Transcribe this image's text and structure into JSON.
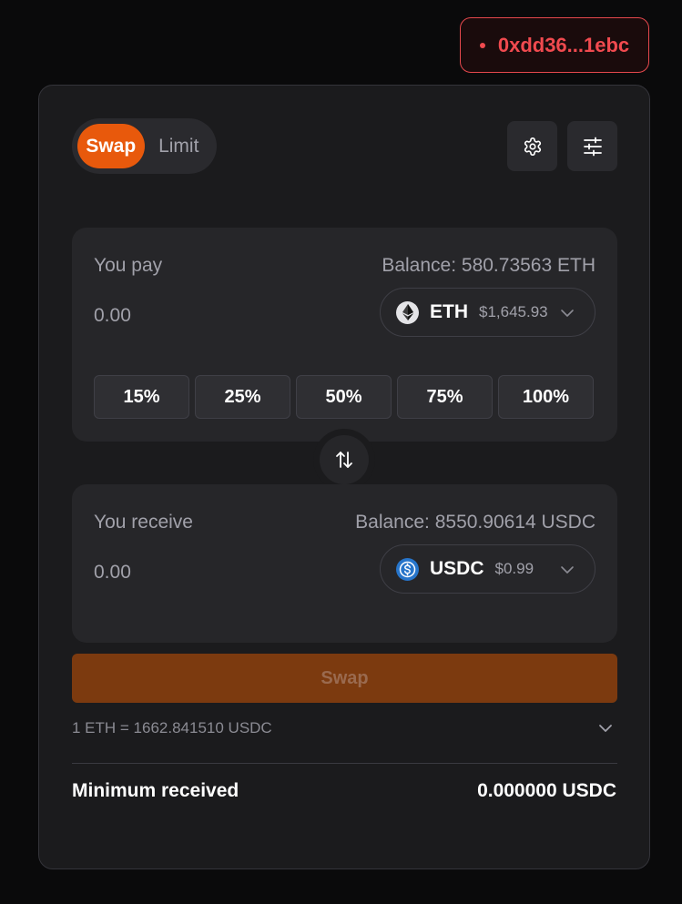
{
  "wallet": {
    "address": "0xdd36...1ebc",
    "status_color": "#f04a4f"
  },
  "mode": {
    "active": "Swap",
    "tabs": [
      "Swap",
      "Limit"
    ]
  },
  "toolbar": {
    "settings_icon": "gear-icon",
    "filters_icon": "sliders-icon"
  },
  "pay": {
    "label": "You pay",
    "balance": "Balance: 580.73563 ETH",
    "amount_placeholder": "0.00",
    "token": {
      "symbol": "ETH",
      "price": "$1,645.93",
      "icon": "ethereum-icon"
    },
    "percent_buttons": [
      "15%",
      "25%",
      "50%",
      "75%",
      "100%"
    ]
  },
  "receive": {
    "label": "You receive",
    "balance": "Balance: 8550.90614 USDC",
    "amount_placeholder": "0.00",
    "token": {
      "symbol": "USDC",
      "price": "$0.99",
      "icon": "usdc-icon"
    }
  },
  "swap_button": {
    "label": "Swap",
    "color": "#7c3a0f"
  },
  "rate": {
    "text": "1 ETH = 1662.841510 USDC"
  },
  "minimum": {
    "label": "Minimum received",
    "value": "0.000000 USDC"
  },
  "colors": {
    "accent": "#e8590c",
    "background": "#0a0a0b",
    "card": "#1b1b1d",
    "panel": "#262629"
  }
}
